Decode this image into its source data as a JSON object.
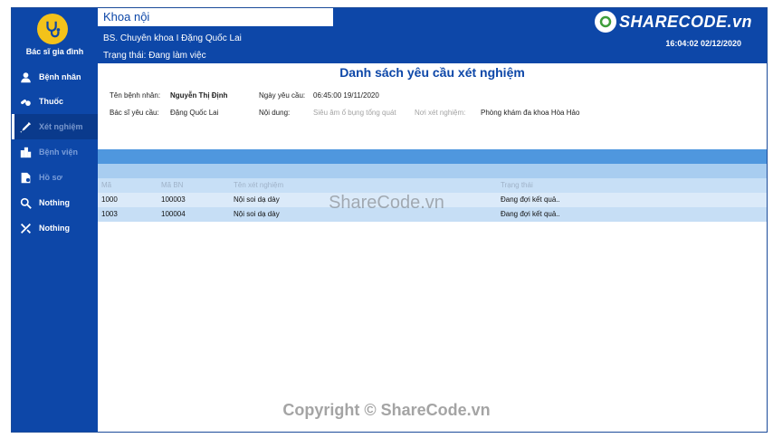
{
  "app": {
    "name": "Bác sĩ gia đình",
    "department": "Khoa nội",
    "doctor": "BS. Chuyên khoa I Đặng Quốc Lai",
    "status": "Trạng thái: Đang làm việc",
    "clock": "16:04:02 02/12/2020",
    "brand": "SHARECODE.vn"
  },
  "sidebar": {
    "items": [
      {
        "label": "Bệnh nhân",
        "icon": "user-icon"
      },
      {
        "label": "Thuốc",
        "icon": "pills-icon"
      },
      {
        "label": "Xét nghiệm",
        "icon": "syringe-icon"
      },
      {
        "label": "Bệnh viện",
        "icon": "hospital-icon"
      },
      {
        "label": "Hồ sơ",
        "icon": "file-icon"
      },
      {
        "label": "Nothing",
        "icon": "search-icon"
      },
      {
        "label": "Nothing",
        "icon": "tools-icon"
      }
    ]
  },
  "main": {
    "title": "Danh sách yêu cầu xét nghiệm",
    "patient_label": "Tên bệnh nhân:",
    "patient_value": "Nguyễn Thị Định",
    "date_label": "Ngày yêu cầu:",
    "date_value": "06:45:00 19/11/2020",
    "doctor_label": "Bác sĩ yêu cầu:",
    "doctor_value": "Đặng Quốc Lai",
    "content_label": "Nội dung:",
    "content_value": "Siêu âm ổ bụng tổng quát",
    "place_label": "Nơi xét nghiệm:",
    "place_value": "Phòng khám đa khoa Hòa Hảo"
  },
  "table": {
    "header": [
      "Mã",
      "Mã BN",
      "Tên xét nghiệm",
      "Trạng thái"
    ],
    "rows": [
      {
        "id": "1000",
        "code": "100003",
        "name": "Nội soi dạ dày",
        "status": "Đang đợi kết quả.."
      },
      {
        "id": "1003",
        "code": "100004",
        "name": "Nội soi dạ dày",
        "status": "Đang đợi kết quả.."
      }
    ]
  },
  "watermark": "ShareCode.vn",
  "copyright": "Copyright © ShareCode.vn",
  "colors": {
    "primary": "#0d47a8",
    "accent": "#f3c21a",
    "row_a": "#dbeaf9",
    "row_b": "#c6def5"
  }
}
